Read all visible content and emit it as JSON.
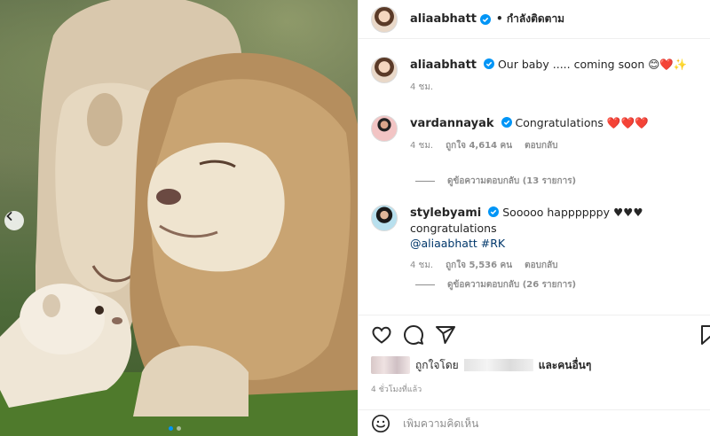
{
  "post": {
    "username": "aliaabhatt",
    "follow_status": "• กำลังติดตาม",
    "caption_user": "aliaabhatt",
    "caption_text": "Our baby ..... coming soon 😊❤️✨",
    "caption_time": "4 ชม."
  },
  "comments": [
    {
      "user": "vardannayak",
      "text": "Congratulations ❤️❤️❤️",
      "time": "4 ชม.",
      "likes": "ถูกใจ 4,614 คน",
      "reply": "ตอบกลับ",
      "view_replies": "ดูข้อความตอบกลับ (13 รายการ)"
    },
    {
      "user": "stylebyami",
      "text": "Sooooo happppppy ♥♥♥ congratulations",
      "mention": "@aliaabhatt #RK",
      "time": "4 ชม.",
      "likes": "ถูกใจ 5,536 คน",
      "reply": "ตอบกลับ",
      "view_replies": "ดูข้อความตอบกลับ (26 รายการ)"
    }
  ],
  "likes_row": {
    "liked_by": "ถูกใจโดย",
    "and_others": "และคนอื่นๆ"
  },
  "timestamp": "4 ชั่วโมงที่แล้ว",
  "add_comment": {
    "placeholder": "เพิ่มความคิดเห็น"
  },
  "icons": {
    "heart": "heart-icon",
    "comment": "comment-icon",
    "share": "share-icon",
    "save": "bookmark-icon",
    "emoji": "smiley-icon",
    "prev": "chevron-left-icon"
  },
  "colors": {
    "verified": "#0095f6",
    "heart": "#ed1c24",
    "link": "#00376b",
    "muted": "#8e8e8e"
  }
}
